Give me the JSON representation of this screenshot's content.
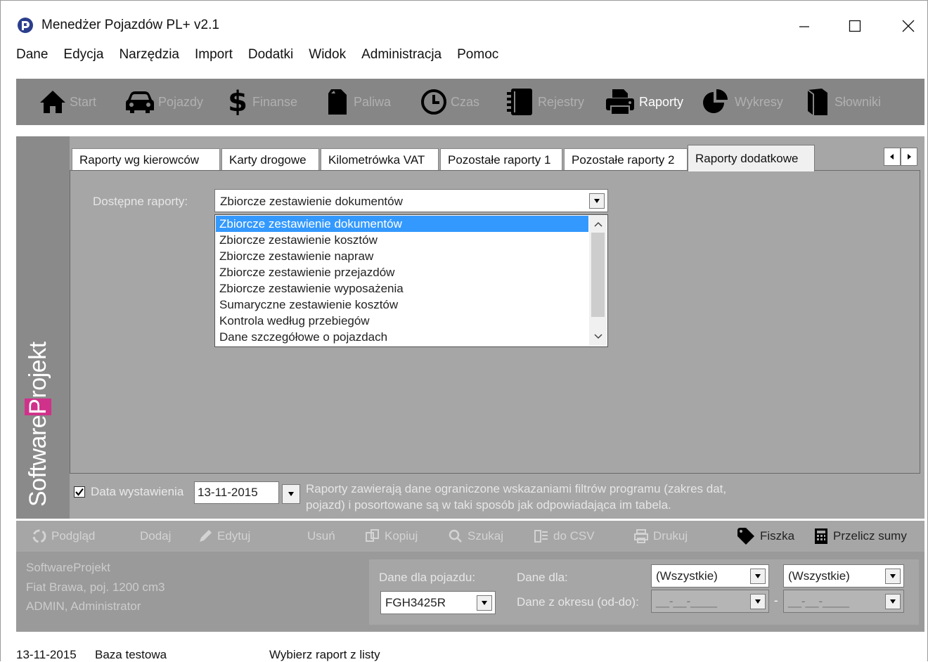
{
  "window": {
    "title": "Menedżer Pojazdów PL+   v2.1"
  },
  "menu": [
    "Dane",
    "Edycja",
    "Narzędzia",
    "Import",
    "Dodatki",
    "Widok",
    "Administracja",
    "Pomoc"
  ],
  "toolbar": [
    {
      "label": "Start",
      "icon": "home-icon"
    },
    {
      "label": "Pojazdy",
      "icon": "car-icon"
    },
    {
      "label": "Finanse",
      "icon": "dollar-icon"
    },
    {
      "label": "Paliwa",
      "icon": "fuel-can-icon"
    },
    {
      "label": "Czas",
      "icon": "clock-icon"
    },
    {
      "label": "Rejestry",
      "icon": "notebook-icon"
    },
    {
      "label": "Raporty",
      "icon": "printer-icon"
    },
    {
      "label": "Wykresy",
      "icon": "pie-chart-icon"
    },
    {
      "label": "Słowniki",
      "icon": "book-icon"
    }
  ],
  "brand": {
    "left": "Software",
    "highlight": "P",
    "right": "rojekt"
  },
  "tabs": [
    "Raporty wg kierowców",
    "Karty drogowe",
    "Kilometrówka VAT",
    "Pozostałe raporty 1",
    "Pozostałe raporty 2",
    "Raporty dodatkowe"
  ],
  "reports": {
    "label": "Dostępne raporty:",
    "selected": "Zbiorcze zestawienie dokumentów",
    "options": [
      "Zbiorcze zestawienie dokumentów",
      "Zbiorcze zestawienie kosztów",
      "Zbiorcze zestawienie napraw",
      "Zbiorcze zestawienie przejazdów",
      "Zbiorcze zestawienie wyposażenia",
      "Sumaryczne zestawienie kosztów",
      "Kontrola według przebiegów",
      "Dane szczegółowe o pojazdach"
    ]
  },
  "date_filter": {
    "checked": true,
    "label": "Data wystawienia",
    "value": "13-11-2015",
    "info_line1": "Raporty zawierają dane ograniczone wskazaniami filtrów programu (zakres dat,",
    "info_line2": "pojazd) i posortowane są w taki sposób jak odpowiadająca im tabela."
  },
  "actions": {
    "preview": "Podgląd",
    "add": "Dodaj",
    "edit": "Edytuj",
    "delete": "Usuń",
    "copy": "Kopiuj",
    "search": "Szukaj",
    "csv": "do CSV",
    "print": "Drukuj",
    "tag": "Fiszka",
    "recalc": "Przelicz sumy"
  },
  "info": {
    "line1": "SoftwareProjekt",
    "line2": "Fiat Brawa, poj. 1200 cm3",
    "line3": "ADMIN, Administrator"
  },
  "filters": {
    "vehicle_label": "Dane dla pojazdu:",
    "vehicle_value": "FGH3425R",
    "for_label": "Dane dla:",
    "for_value1": "(Wszystkie)",
    "for_value2": "(Wszystkie)",
    "period_label": "Dane z okresu (od-do):",
    "period_from": "__-__-____",
    "period_to": "__-__-____",
    "dash": "-"
  },
  "status": {
    "date": "13-11-2015",
    "db": "Baza testowa",
    "message": "Wybierz raport z listy"
  },
  "colors": {
    "toolbar_bg": "#868686",
    "main_bg": "#a6a6a6",
    "selection": "#3399ff",
    "brand_accent": "#d0318a",
    "app_icon": "#2a3e8c"
  }
}
